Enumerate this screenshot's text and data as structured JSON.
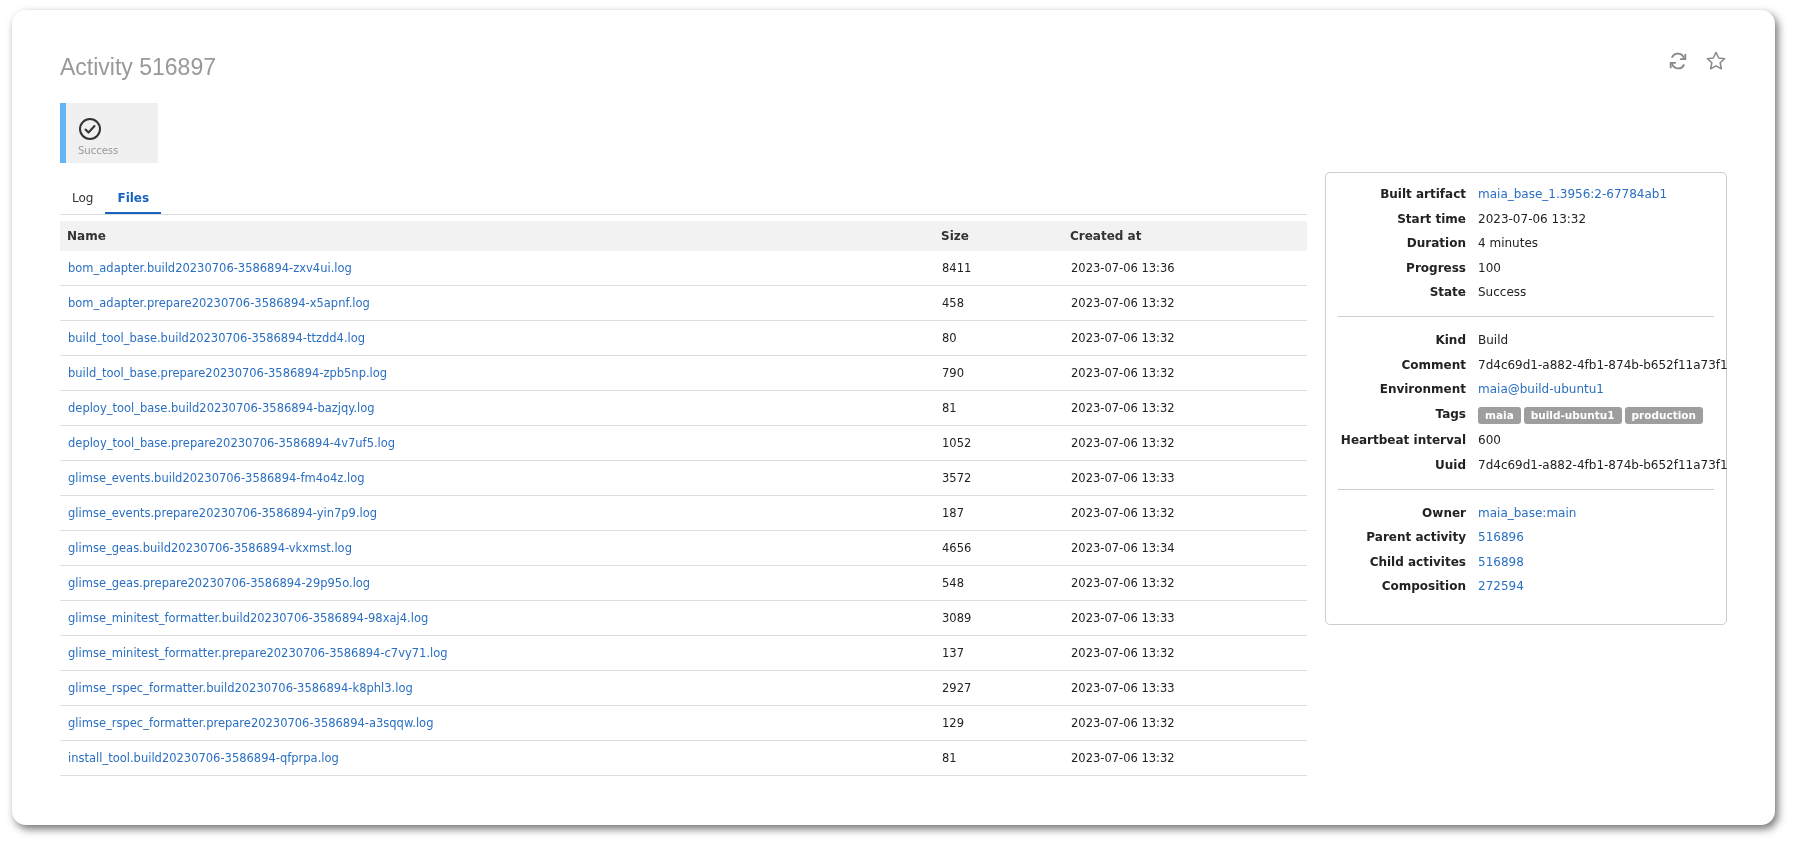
{
  "title": "Activity 516897",
  "status": {
    "label": "Success",
    "kind": "success"
  },
  "tabs": [
    {
      "label": "Log",
      "selected": false
    },
    {
      "label": "Files",
      "selected": true
    }
  ],
  "table": {
    "columns": [
      "Name",
      "Size",
      "Created at"
    ],
    "rows": [
      {
        "name": "bom_adapter.build20230706-3586894-zxv4ui.log",
        "size": "8411",
        "created_at": "2023-07-06 13:36"
      },
      {
        "name": "bom_adapter.prepare20230706-3586894-x5apnf.log",
        "size": "458",
        "created_at": "2023-07-06 13:32"
      },
      {
        "name": "build_tool_base.build20230706-3586894-ttzdd4.log",
        "size": "80",
        "created_at": "2023-07-06 13:32"
      },
      {
        "name": "build_tool_base.prepare20230706-3586894-zpb5np.log",
        "size": "790",
        "created_at": "2023-07-06 13:32"
      },
      {
        "name": "deploy_tool_base.build20230706-3586894-bazjqy.log",
        "size": "81",
        "created_at": "2023-07-06 13:32"
      },
      {
        "name": "deploy_tool_base.prepare20230706-3586894-4v7uf5.log",
        "size": "1052",
        "created_at": "2023-07-06 13:32"
      },
      {
        "name": "glimse_events.build20230706-3586894-fm4o4z.log",
        "size": "3572",
        "created_at": "2023-07-06 13:33"
      },
      {
        "name": "glimse_events.prepare20230706-3586894-yin7p9.log",
        "size": "187",
        "created_at": "2023-07-06 13:32"
      },
      {
        "name": "glimse_geas.build20230706-3586894-vkxmst.log",
        "size": "4656",
        "created_at": "2023-07-06 13:34"
      },
      {
        "name": "glimse_geas.prepare20230706-3586894-29p95o.log",
        "size": "548",
        "created_at": "2023-07-06 13:32"
      },
      {
        "name": "glimse_minitest_formatter.build20230706-3586894-98xaj4.log",
        "size": "3089",
        "created_at": "2023-07-06 13:33"
      },
      {
        "name": "glimse_minitest_formatter.prepare20230706-3586894-c7vy71.log",
        "size": "137",
        "created_at": "2023-07-06 13:32"
      },
      {
        "name": "glimse_rspec_formatter.build20230706-3586894-k8phl3.log",
        "size": "2927",
        "created_at": "2023-07-06 13:33"
      },
      {
        "name": "glimse_rspec_formatter.prepare20230706-3586894-a3sqqw.log",
        "size": "129",
        "created_at": "2023-07-06 13:32"
      },
      {
        "name": "install_tool.build20230706-3586894-qfprpa.log",
        "size": "81",
        "created_at": "2023-07-06 13:32"
      }
    ]
  },
  "details": [
    [
      {
        "label": "Built artifact",
        "kind": "link",
        "value": "maia_base_1.3956:2-67784ab1"
      },
      {
        "label": "Start time",
        "kind": "text",
        "value": "2023-07-06 13:32"
      },
      {
        "label": "Duration",
        "kind": "text",
        "value": "4 minutes"
      },
      {
        "label": "Progress",
        "kind": "text",
        "value": "100"
      },
      {
        "label": "State",
        "kind": "text",
        "value": "Success"
      }
    ],
    [
      {
        "label": "Kind",
        "kind": "text",
        "value": "Build"
      },
      {
        "label": "Comment",
        "kind": "text",
        "value": "7d4c69d1-a882-4fb1-874b-b652f11a73f1"
      },
      {
        "label": "Environment",
        "kind": "link",
        "value": "maia@build-ubuntu1"
      },
      {
        "label": "Tags",
        "kind": "tags",
        "tags": [
          "maia",
          "build-ubuntu1",
          "production"
        ]
      },
      {
        "label": "Heartbeat interval",
        "kind": "text",
        "value": "600"
      },
      {
        "label": "Uuid",
        "kind": "text",
        "value": "7d4c69d1-a882-4fb1-874b-b652f11a73f1"
      }
    ],
    [
      {
        "label": "Owner",
        "kind": "link",
        "value": "maia_base:main"
      },
      {
        "label": "Parent activity",
        "kind": "link",
        "value": "516896"
      },
      {
        "label": "Child activites",
        "kind": "link",
        "value": "516898"
      },
      {
        "label": "Composition",
        "kind": "link",
        "value": "272594"
      }
    ]
  ]
}
